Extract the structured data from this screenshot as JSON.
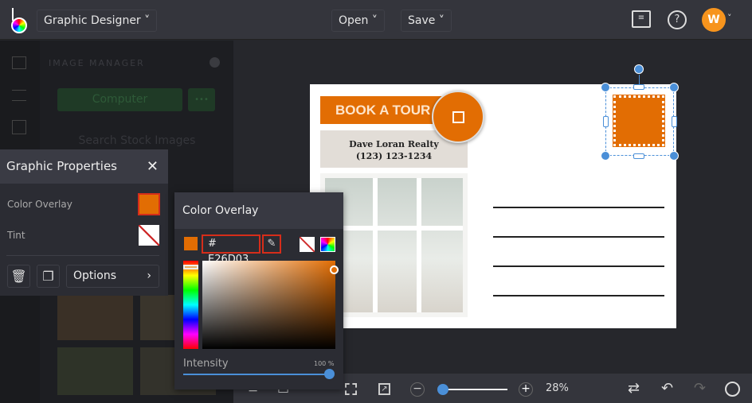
{
  "topbar": {
    "app_menu": "Graphic Designer",
    "open": "Open",
    "save": "Save",
    "avatar_initial": "W"
  },
  "image_manager": {
    "title": "IMAGE MANAGER",
    "computer": "Computer",
    "more": "•••",
    "search": "Search Stock Images"
  },
  "graphic_properties": {
    "title": "Graphic Properties",
    "color_overlay_label": "Color Overlay",
    "tint_label": "Tint",
    "options": "Options",
    "overlay_color": "#E26D03"
  },
  "color_overlay": {
    "title": "Color Overlay",
    "hash": "#",
    "hex": "E26D03",
    "intensity_label": "Intensity",
    "intensity_value": "100 %",
    "intensity": 100
  },
  "postcard": {
    "banner": "BOOK A TOUR TODAY",
    "company": "Dave Loran Realty",
    "phone": "(123) 123-1234"
  },
  "bottombar": {
    "zoom": "28%",
    "zoom_level": 28
  },
  "colors": {
    "accent": "#E26D03",
    "selection": "#4a8fd8"
  }
}
